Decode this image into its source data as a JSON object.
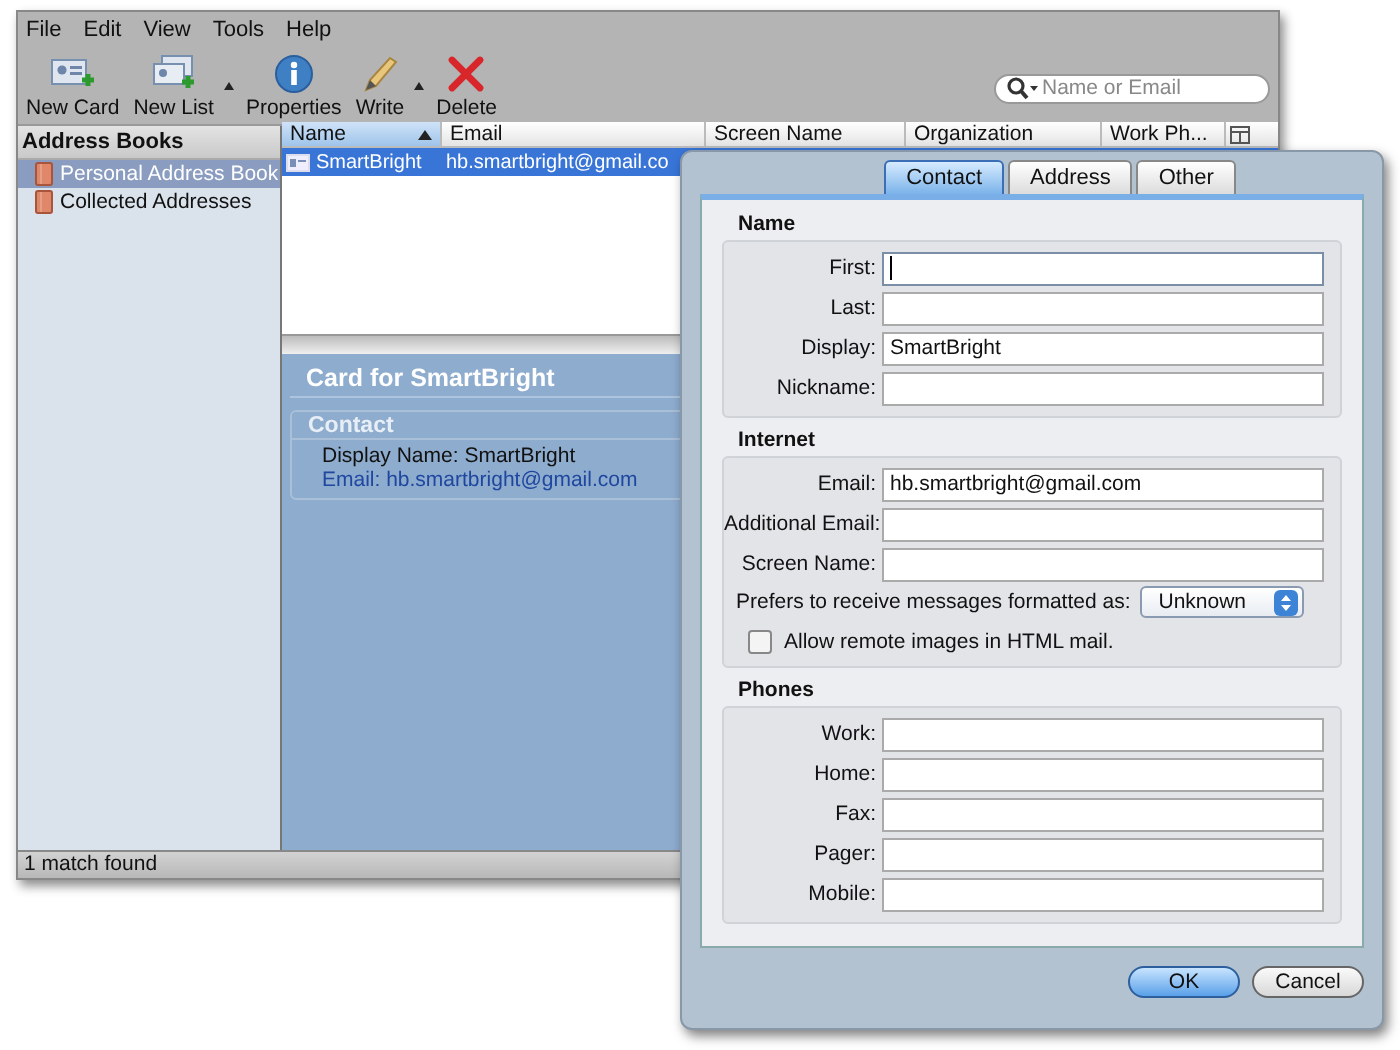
{
  "menu": [
    "File",
    "Edit",
    "View",
    "Tools",
    "Help"
  ],
  "toolbar": [
    {
      "kind": "new-card",
      "label": "New Card",
      "has_menu": false
    },
    {
      "kind": "new-list",
      "label": "New List",
      "has_menu": true
    },
    {
      "kind": "properties",
      "label": "Properties",
      "has_menu": false
    },
    {
      "kind": "write",
      "label": "Write",
      "has_menu": true
    },
    {
      "kind": "delete",
      "label": "Delete",
      "has_menu": false
    }
  ],
  "search": {
    "placeholder": "Name or Email"
  },
  "sidebar": {
    "title": "Address Books",
    "items": [
      {
        "label": "Personal Address Book",
        "selected": true
      },
      {
        "label": "Collected Addresses",
        "selected": false
      }
    ]
  },
  "table": {
    "columns": [
      {
        "label": "Name",
        "sorted": true
      },
      {
        "label": "Email",
        "sorted": false
      },
      {
        "label": "Screen Name",
        "sorted": false
      },
      {
        "label": "Organization",
        "sorted": false
      },
      {
        "label": "Work Ph...",
        "sorted": false
      }
    ],
    "rows": [
      {
        "cells": [
          "SmartBright",
          "hb.smartbright@gmail.co"
        ],
        "selected": true
      }
    ]
  },
  "card": {
    "title": "Card for SmartBright",
    "section": "Contact",
    "lines": [
      {
        "kind": "plain",
        "text": "Display Name: SmartBright"
      },
      {
        "kind": "link",
        "text": "Email: hb.smartbright@gmail.com"
      }
    ]
  },
  "status_bar": "1 match found",
  "dialog": {
    "tabs": [
      {
        "label": "Contact",
        "selected": true
      },
      {
        "label": "Address",
        "selected": false
      },
      {
        "label": "Other",
        "selected": false
      }
    ],
    "sections": [
      {
        "title": "Name",
        "fields": [
          {
            "label": "First:",
            "focused": true
          },
          {
            "label": "Last:",
            "focused": false
          },
          {
            "label": "Display:",
            "value": "SmartBright",
            "focused": false
          },
          {
            "label": "Nickname:",
            "focused": false
          }
        ]
      },
      {
        "title": "Internet",
        "fields": [
          {
            "label": "Email:",
            "value": "hb.smartbright@gmail.com",
            "focused": false
          },
          {
            "label": "Additional Email:",
            "focused": false
          },
          {
            "label": "Screen Name:",
            "focused": false
          }
        ],
        "format": {
          "label": "Prefers to receive messages formatted as:",
          "value": "Unknown"
        },
        "checkbox": {
          "label": "Allow remote images in HTML mail.",
          "checked": false
        }
      },
      {
        "title": "Phones",
        "fields": [
          {
            "label": "Work:",
            "focused": false
          },
          {
            "label": "Home:",
            "focused": false
          },
          {
            "label": "Fax:",
            "focused": false
          },
          {
            "label": "Pager:",
            "focused": false
          },
          {
            "label": "Mobile:",
            "focused": false
          }
        ]
      }
    ],
    "buttons": [
      {
        "label": "OK",
        "default": true
      },
      {
        "label": "Cancel",
        "default": false
      }
    ]
  }
}
